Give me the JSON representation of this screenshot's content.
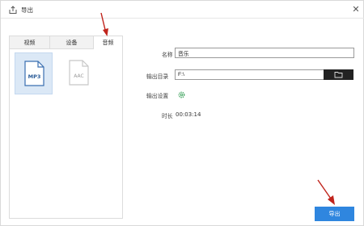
{
  "window": {
    "title": "导出",
    "close_glyph": "✕"
  },
  "tabs": [
    {
      "label": "视频"
    },
    {
      "label": "设备"
    },
    {
      "label": "音频"
    }
  ],
  "formats": [
    {
      "label": "MP3",
      "selected": true,
      "icon": "mp3-file-icon"
    },
    {
      "label": "AAC",
      "selected": false,
      "icon": "aac-file-icon"
    }
  ],
  "form": {
    "name_label": "名称",
    "name_value": "音乐",
    "output_dir_label": "输出目录",
    "output_dir_value": "F:\\",
    "output_settings_label": "输出设置",
    "duration_label": "时长",
    "duration_value": "00:03:14"
  },
  "export_button": "导出",
  "colors": {
    "accent": "#2f86df",
    "annotation_arrow": "#c0241c",
    "selected_bg": "#dbe8f6"
  }
}
